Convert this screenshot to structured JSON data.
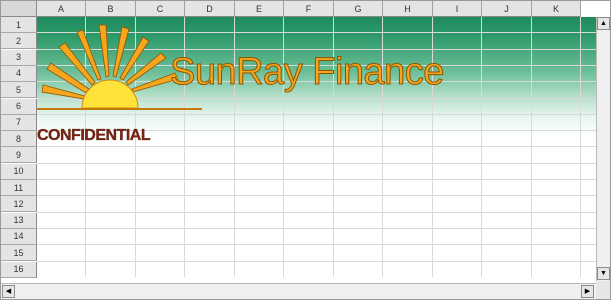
{
  "spreadsheet": {
    "columns": [
      "A",
      "B",
      "C",
      "D",
      "E",
      "F",
      "G",
      "H",
      "I",
      "J",
      "K"
    ],
    "rows": [
      "1",
      "2",
      "3",
      "4",
      "5",
      "6",
      "7",
      "8",
      "9",
      "10",
      "11",
      "12",
      "13",
      "14",
      "15",
      "16"
    ]
  },
  "logo": {
    "company_name": "SunRay Finance",
    "sun_color": "#f5a51e",
    "sun_core_color": "#ffe23a",
    "header_gradient_color": "#1f8a5c"
  },
  "label": {
    "confidential": "CONFIDENTIAL",
    "color": "#7a2412"
  },
  "scrollbars": {
    "up_arrow": "▲",
    "down_arrow": "▼",
    "left_arrow": "◀",
    "right_arrow": "▶"
  }
}
